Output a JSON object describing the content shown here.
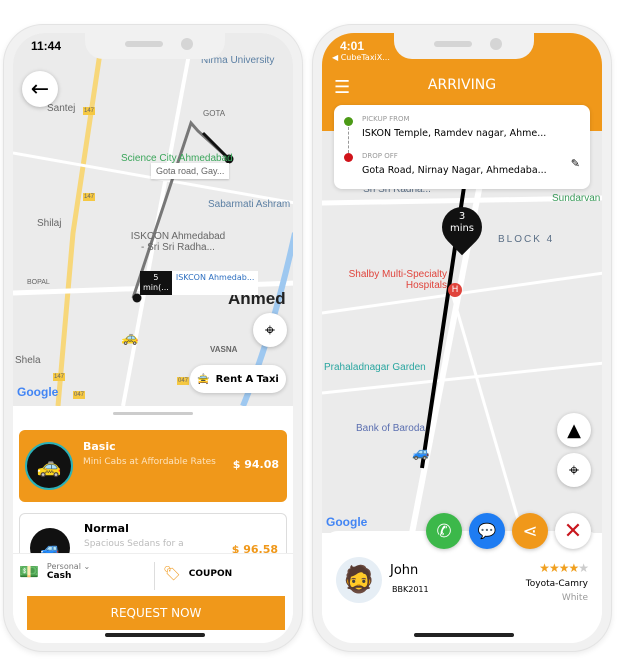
{
  "left": {
    "status_time": "11:44",
    "map_labels": [
      "Nirma University",
      "Santej",
      "GOTA",
      "Science City Ahmedabad",
      "Sabarmati Ashram",
      "Shilaj",
      "ISKCON Ahmedabad - Sri Sri Radha...",
      "BOPAL",
      "Ahmed",
      "VASNA",
      "Shela",
      "147",
      "147",
      "147",
      "047",
      "047"
    ],
    "drop_tooltip": "Gota road, Gay...",
    "eta_value": "5",
    "eta_unit": "min(...",
    "pickup_tooltip": "ISKCON Ahmedab...",
    "rent_taxi_label": "Rent A Taxi",
    "google": "Google",
    "rides": [
      {
        "name": "Basic",
        "desc": "Mini Cabs at Affordable Rates",
        "price": "$ 94.08",
        "selected": true
      },
      {
        "name": "Normal",
        "desc": "Spacious Sedans for a",
        "price": "$ 96.58",
        "selected": false
      }
    ],
    "payment_type": "Personal",
    "payment_method": "Cash",
    "coupon_label": "COUPON",
    "request_label": "REQUEST NOW"
  },
  "right": {
    "status_time": "4:01",
    "back_app": "◀ CubeTaxiX...",
    "title": "ARRIVING",
    "pickup_label": "PICKUP FROM",
    "pickup_value": "ISKON Temple, Ramdev nagar, Ahme...",
    "drop_label": "DROP OFF",
    "drop_value": "Gota Road, Nirnay Nagar, Ahmedaba...",
    "eta_value": "3",
    "eta_unit": "mins",
    "map_labels": [
      "ISKCON Ahmedabad - Sri Sri Radha...",
      "Sundarvan",
      "BLOCK 4",
      "Shalby Multi-Specialty Hospitals",
      "Prahaladnagar Garden",
      "Bank of Baroda"
    ],
    "google": "Google",
    "driver_name": "John",
    "driver_plate": "BBK2011",
    "rating": 4,
    "rating_max": 5,
    "car_model": "Toyota-Camry",
    "car_color": "White"
  },
  "colors": {
    "accent": "#f0981a",
    "call": "#3cb84a",
    "chat": "#1e7cf2",
    "cancel": "#c8161d",
    "pickup_dot": "#4c9a16",
    "drop_dot": "#d0131a"
  }
}
